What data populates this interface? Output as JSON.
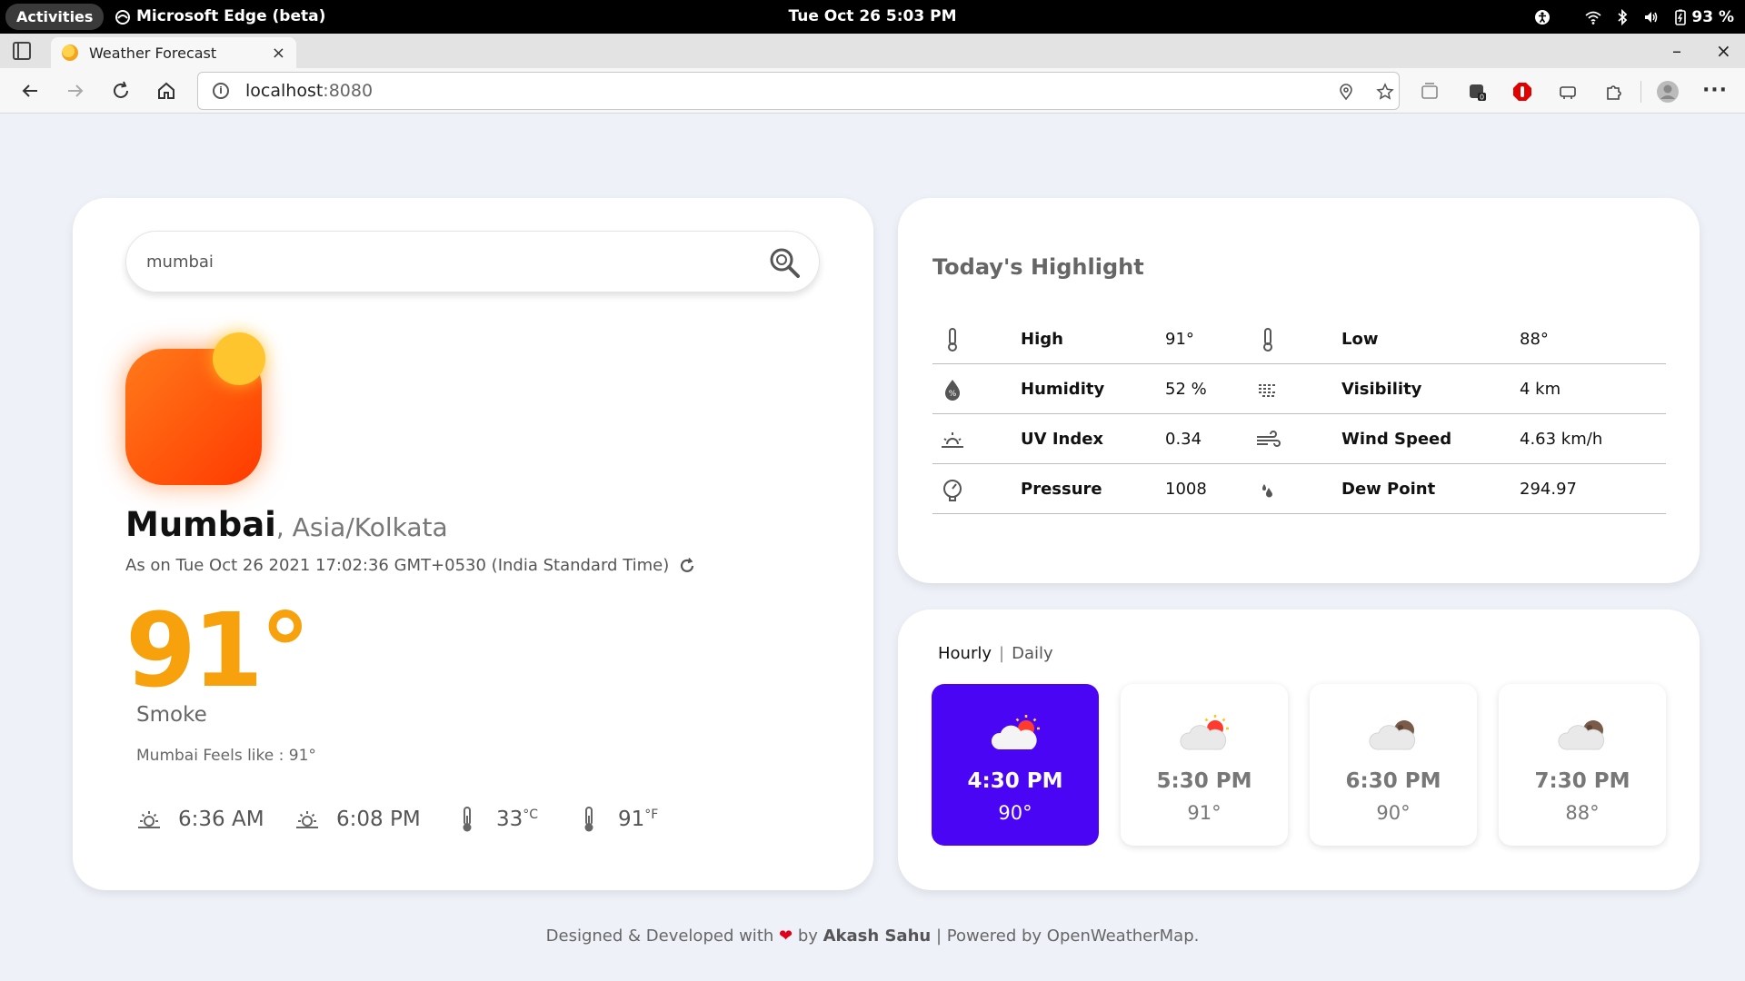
{
  "system": {
    "activities": "Activities",
    "app_name": "Microsoft Edge (beta)",
    "clock": "Tue Oct 26  5:03 PM",
    "battery": "93 %"
  },
  "browser": {
    "tab_title": "Weather Forecast",
    "tab_close": "×",
    "new_tab": "+",
    "url_host": "localhost",
    "url_port": ":8080",
    "window_minimize": "–",
    "window_close": "×"
  },
  "search": {
    "value": "mumbai"
  },
  "current": {
    "city": "Mumbai",
    "timezone": ", Asia/Kolkata",
    "as_of": "As on Tue Oct 26 2021 17:02:36 GMT+0530 (India Standard Time)",
    "temperature": "91°",
    "condition": "Smoke",
    "feels_like": "Mumbai Feels like : 91°",
    "sunrise": "6:36 AM",
    "sunset": "6:08 PM",
    "temp_c": "33",
    "temp_c_unit": "°C",
    "temp_f": "91",
    "temp_f_unit": "°F"
  },
  "highlight": {
    "title": "Today's Highlight",
    "rows": [
      {
        "left_label": "High",
        "left_value": "91°",
        "right_label": "Low",
        "right_value": "88°"
      },
      {
        "left_label": "Humidity",
        "left_value": "52 %",
        "right_label": "Visibility",
        "right_value": "4 km"
      },
      {
        "left_label": "UV Index",
        "left_value": "0.34",
        "right_label": "Wind Speed",
        "right_value": "4.63 km/h"
      },
      {
        "left_label": "Pressure",
        "left_value": "1008",
        "right_label": "Dew Point",
        "right_value": "294.97"
      }
    ]
  },
  "forecast": {
    "tab_hourly": "Hourly",
    "separator": "|",
    "tab_daily": "Daily",
    "hours": [
      {
        "time": "4:30 PM",
        "temp": "90°",
        "icon": "cloud-sun-icon"
      },
      {
        "time": "5:30 PM",
        "temp": "91°",
        "icon": "cloud-sun-icon"
      },
      {
        "time": "6:30 PM",
        "temp": "90°",
        "icon": "cloud-moon-icon"
      },
      {
        "time": "7:30 PM",
        "temp": "88°",
        "icon": "cloud-moon-icon"
      }
    ]
  },
  "footer": {
    "prefix": "Designed & Developed with ",
    "heart": "❤",
    "by": " by ",
    "author": "Akash Sahu",
    "suffix": " | Powered by OpenWeatherMap."
  },
  "colors": {
    "accent_temp": "#f7a20d",
    "active_card": "#4a05f5",
    "page_bg": "#eef1f8"
  }
}
